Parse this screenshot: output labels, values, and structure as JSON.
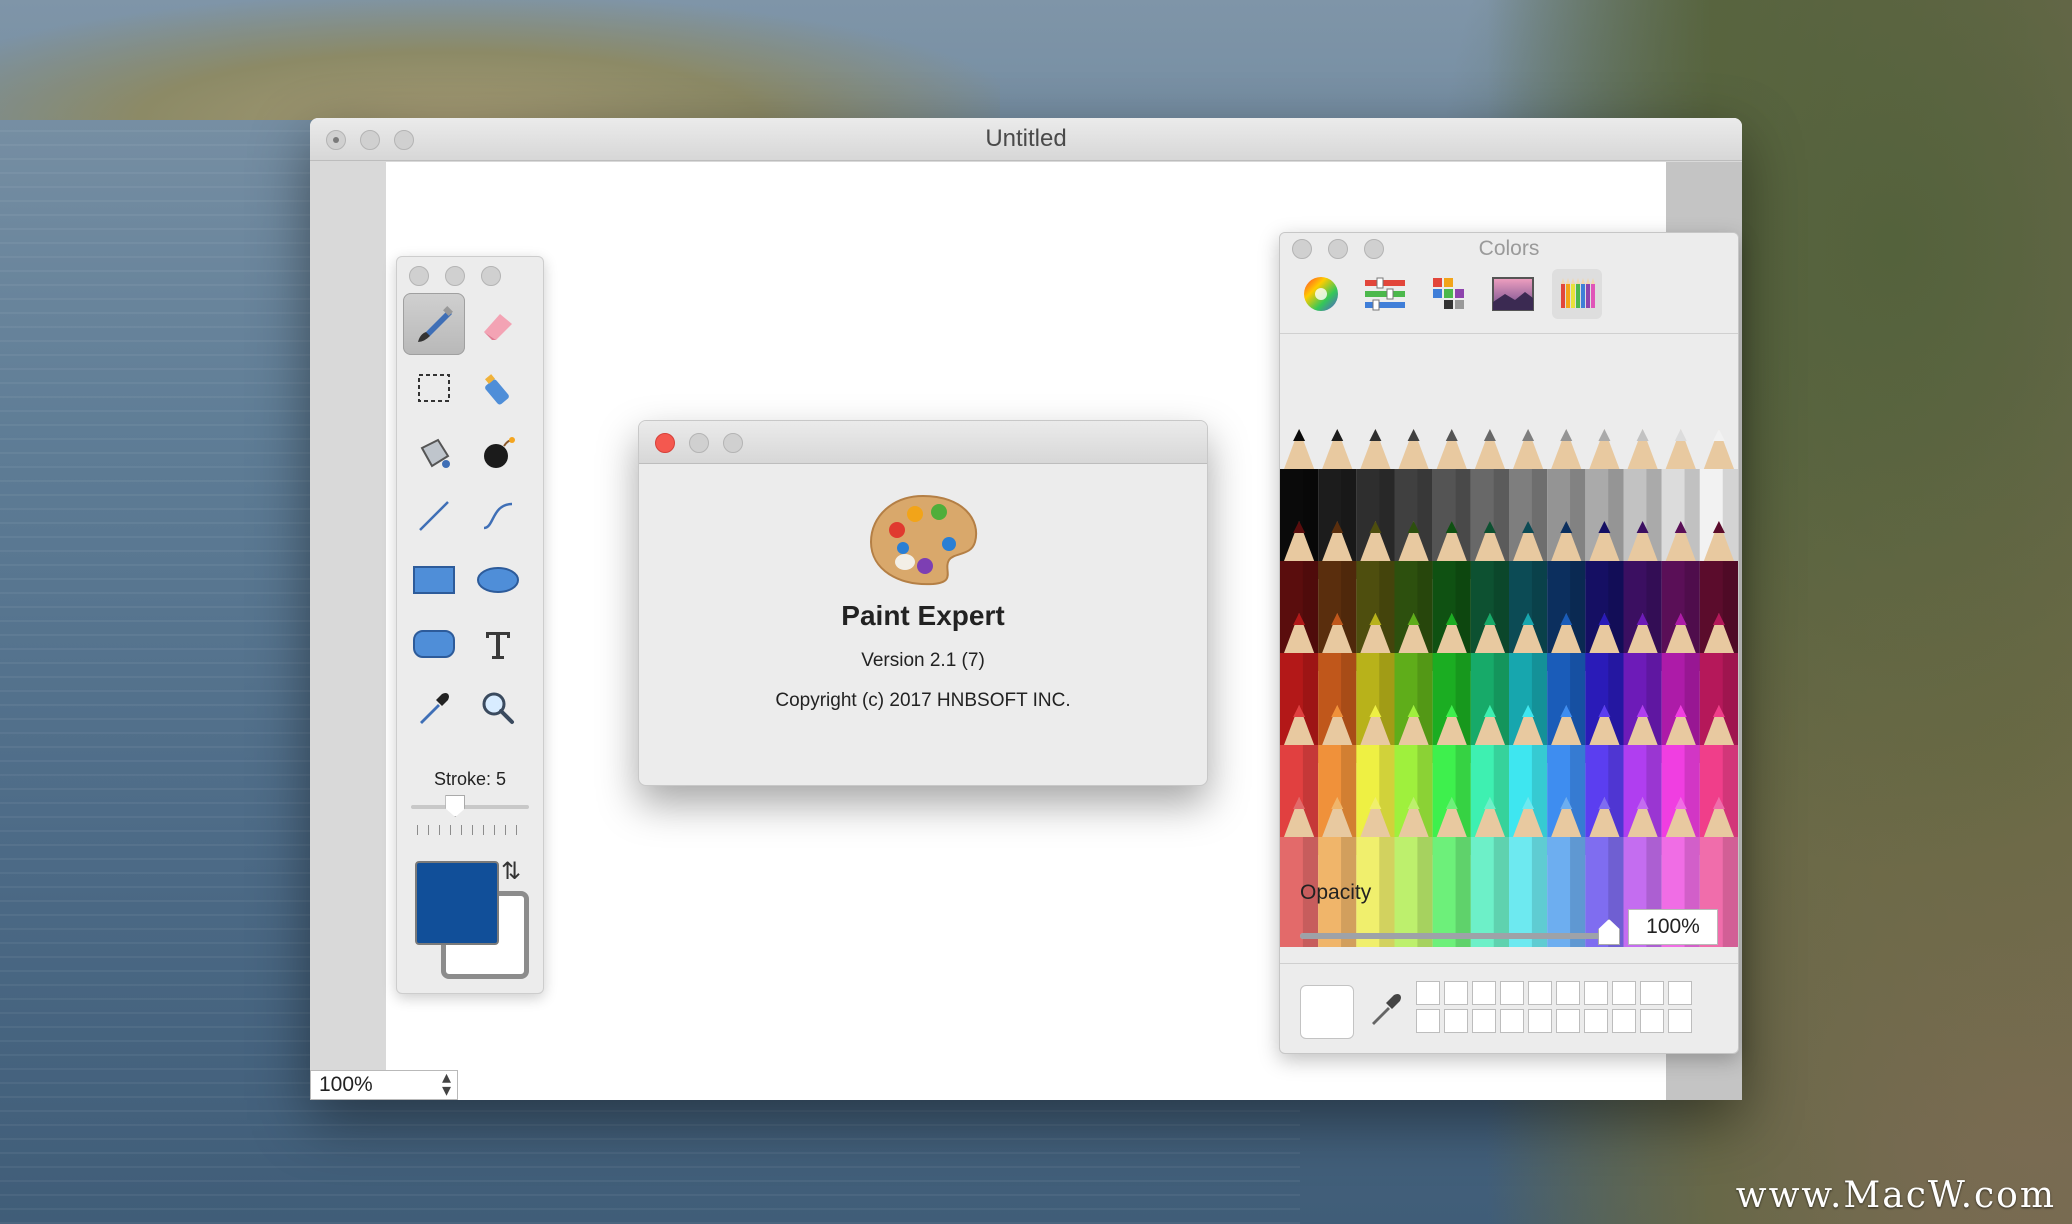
{
  "main_window": {
    "title": "Untitled",
    "zoom": "100%"
  },
  "tools": {
    "items": [
      {
        "name": "brush-icon",
        "selected": true
      },
      {
        "name": "eraser-icon"
      },
      {
        "name": "selection-icon"
      },
      {
        "name": "spray-icon"
      },
      {
        "name": "bucket-icon"
      },
      {
        "name": "bomb-icon"
      },
      {
        "name": "line-icon"
      },
      {
        "name": "curve-icon"
      },
      {
        "name": "rectangle-icon"
      },
      {
        "name": "ellipse-icon"
      },
      {
        "name": "rounded-rect-icon"
      },
      {
        "name": "text-icon"
      },
      {
        "name": "eyedropper-icon"
      },
      {
        "name": "magnifier-icon"
      }
    ],
    "stroke_label": "Stroke: 5",
    "stroke_fraction": 0.35,
    "foreground_color": "#114f99",
    "background_color": "#ffffff"
  },
  "about": {
    "app_name": "Paint Expert",
    "version": "Version 2.1 (7)",
    "copyright": "Copyright (c) 2017 HNBSOFT INC."
  },
  "colors_panel": {
    "title": "Colors",
    "modes": [
      "color-wheel-icon",
      "sliders-icon",
      "palettes-icon",
      "image-icon",
      "pencils-icon"
    ],
    "active_mode": "pencils-icon",
    "opacity_label": "Opacity",
    "opacity_value": "100%",
    "opacity_fraction": 1.0,
    "pencil_rows": [
      [
        "#0a0a0a",
        "#1c1c1c",
        "#2e2e2e",
        "#404040",
        "#545454",
        "#686868",
        "#7e7e7e",
        "#949494",
        "#aaaaaa",
        "#c2c2c2",
        "#dcdcdc",
        "#f2f2f2"
      ],
      [
        "#5a0d0d",
        "#5a2e0d",
        "#4e4e0e",
        "#2d500e",
        "#0f5112",
        "#0d5131",
        "#0c4b55",
        "#0c2f5e",
        "#150f63",
        "#3b0f61",
        "#5a0f57",
        "#5b0c2c"
      ],
      [
        "#b31818",
        "#c0571b",
        "#b8b21a",
        "#5fad1a",
        "#1bad22",
        "#17aa69",
        "#17a6ae",
        "#1a5cb9",
        "#2a1bb8",
        "#6d1bb8",
        "#ad1ba8",
        "#b5185a"
      ],
      [
        "#e14040",
        "#f0913a",
        "#eef043",
        "#9ff03d",
        "#3ef04d",
        "#3ef0b1",
        "#3ee6f0",
        "#3e8df0",
        "#5b3ef0",
        "#b03ef0",
        "#f03ee1",
        "#f03e8a"
      ],
      [
        "#e36a6a",
        "#f0b56a",
        "#f0ef6d",
        "#bdf06d",
        "#6df07a",
        "#6df0c8",
        "#6de9f0",
        "#6daef0",
        "#7f6df0",
        "#c46df0",
        "#f06de5",
        "#f06dab"
      ]
    ],
    "swatch_count": 20
  },
  "watermark": "www.MacW.com"
}
